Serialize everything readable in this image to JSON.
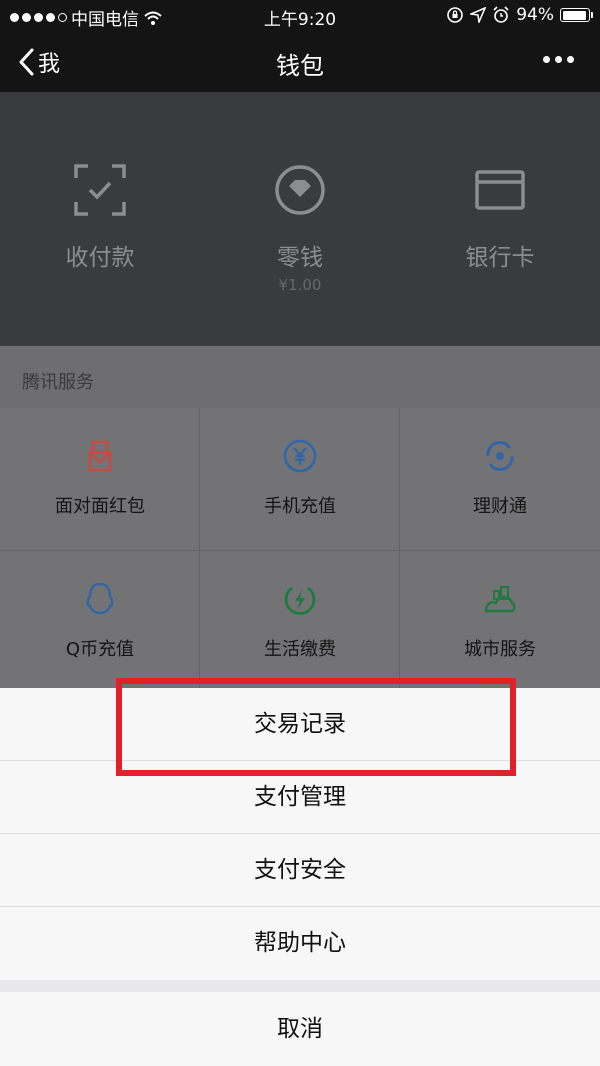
{
  "status_bar": {
    "carrier": "中国电信",
    "time": "上午9:20",
    "battery": "94%",
    "battery_level": 0.94
  },
  "nav": {
    "back_label": "我",
    "title": "钱包"
  },
  "wallet": {
    "items": [
      {
        "label": "收付款",
        "icon": "scan-pay-icon"
      },
      {
        "label": "零钱",
        "sub": "¥1.00",
        "icon": "change-icon"
      },
      {
        "label": "银行卡",
        "icon": "bank-card-icon"
      }
    ]
  },
  "services": {
    "section_title": "腾讯服务",
    "items": [
      {
        "label": "面对面红包",
        "icon": "red-packet-icon",
        "color": "#c84a43"
      },
      {
        "label": "手机充值",
        "icon": "mobile-topup-icon",
        "color": "#2f66a8"
      },
      {
        "label": "理财通",
        "icon": "licaitong-icon",
        "color": "#2f66a8"
      },
      {
        "label": "Q币充值",
        "icon": "qq-coin-icon",
        "color": "#2f66a8"
      },
      {
        "label": "生活缴费",
        "icon": "utility-bill-icon",
        "color": "#1f7a3f"
      },
      {
        "label": "城市服务",
        "icon": "city-service-icon",
        "color": "#1f7a3f"
      }
    ]
  },
  "action_sheet": {
    "items": [
      "交易记录",
      "支付管理",
      "支付安全",
      "帮助中心"
    ],
    "cancel": "取消"
  },
  "colors": {
    "highlight": "#e3202a"
  }
}
